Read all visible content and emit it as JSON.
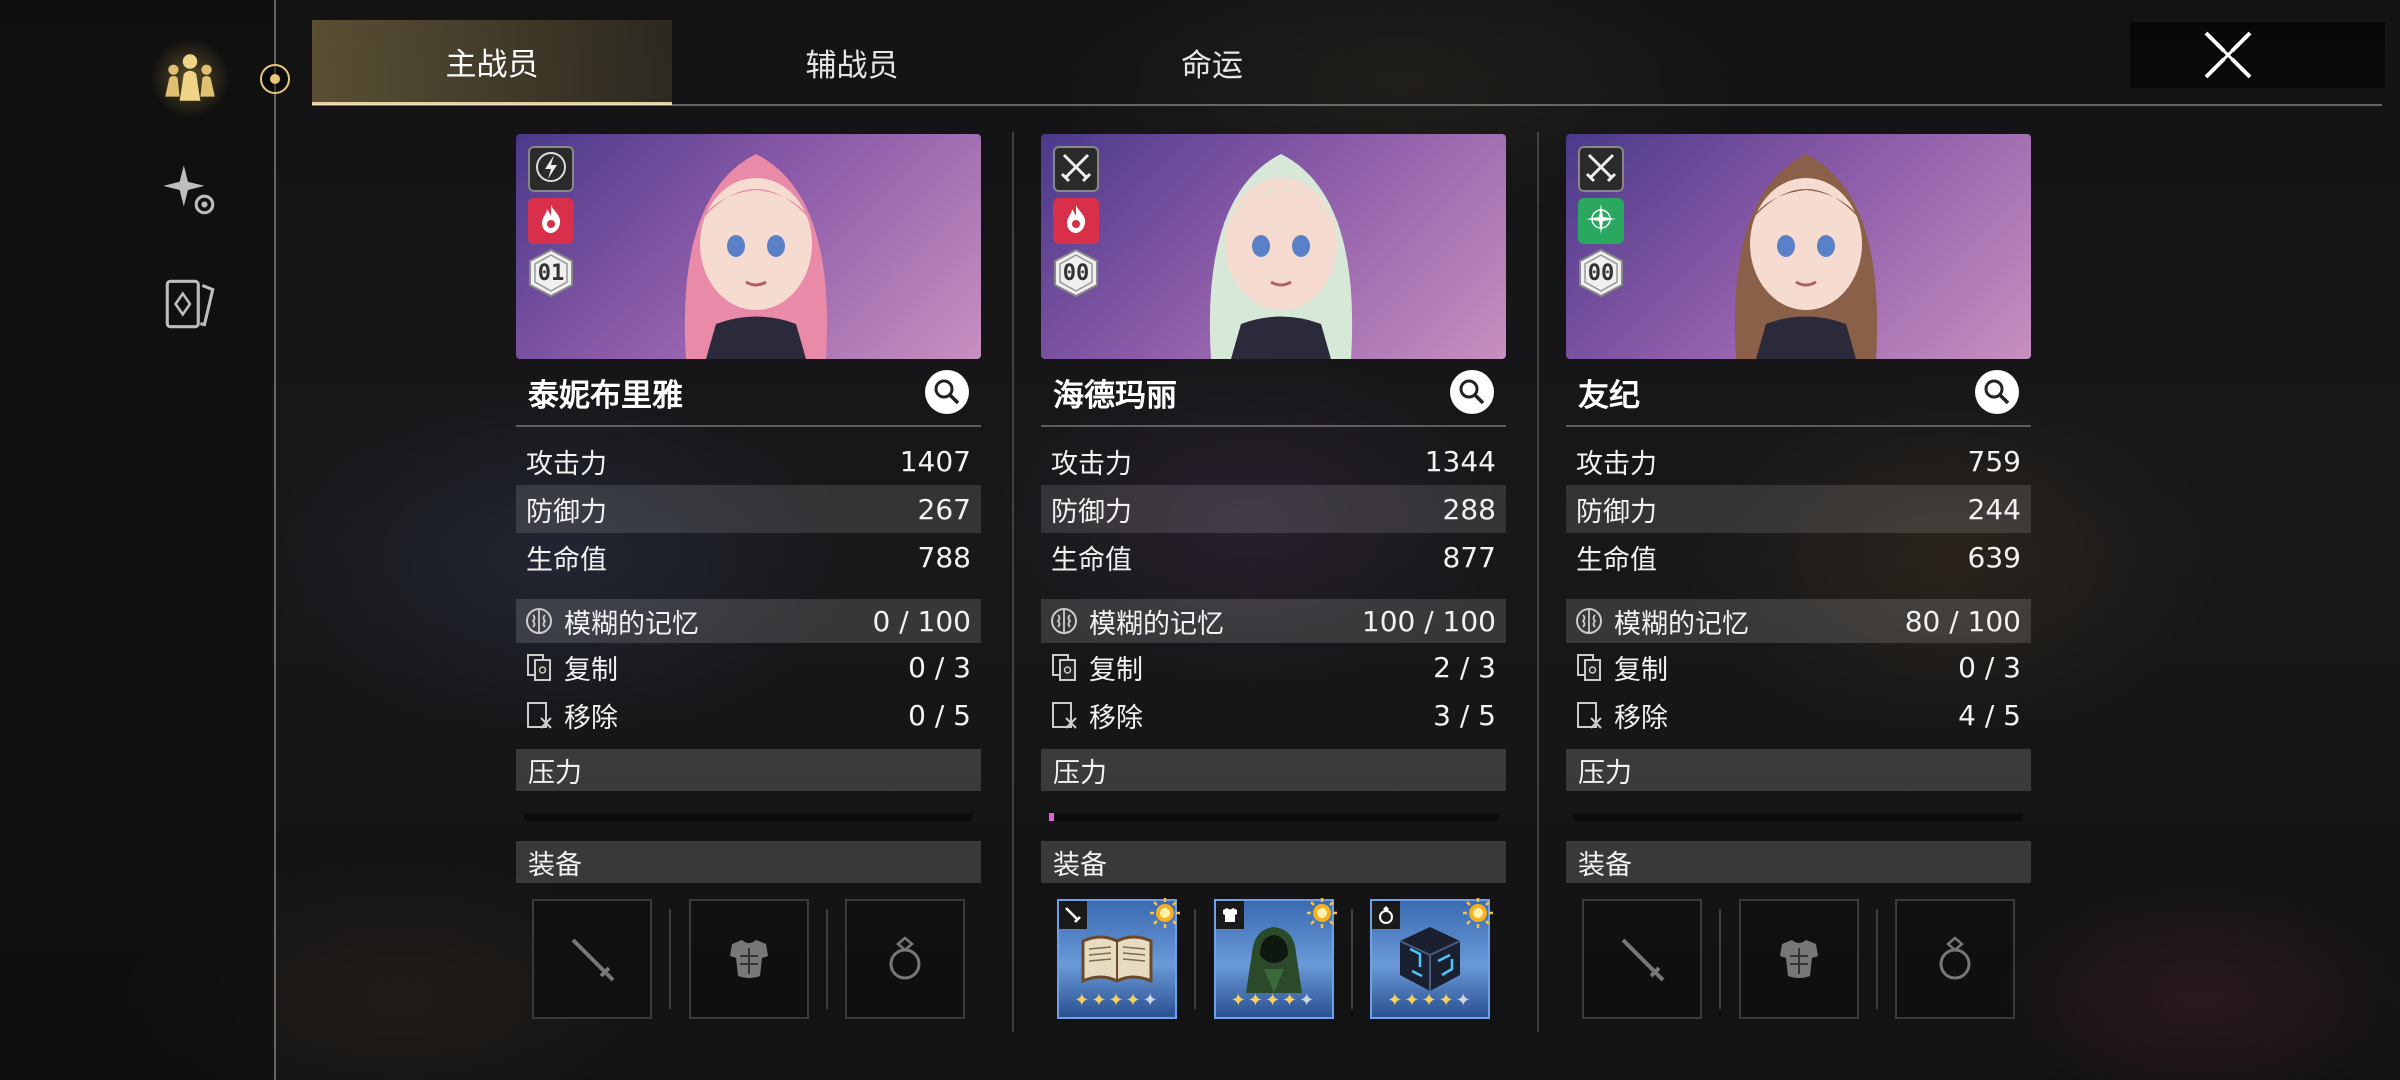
{
  "tabs": [
    {
      "label": "主战员",
      "active": true
    },
    {
      "label": "辅战员",
      "active": false
    },
    {
      "label": "命运",
      "active": false
    }
  ],
  "rail_icons": [
    "team-icon",
    "sparkle-icon",
    "card-icon"
  ],
  "labels": {
    "attack": "攻击力",
    "defense": "防御力",
    "hp": "生命值",
    "memory": "模糊的记忆",
    "copy": "复制",
    "remove": "移除",
    "pressure": "压力",
    "equipment": "装备"
  },
  "characters": [
    {
      "name": "泰妮布里雅",
      "role_icon": "lightning-icon",
      "element_icon": "fire-icon",
      "element_color": "#d8304a",
      "rank": "01",
      "hair": "#e88aa8",
      "attack": "1407",
      "defense": "267",
      "hp": "788",
      "memory": "0 / 100",
      "copy": "0 / 3",
      "remove": "0 / 5",
      "pressure": 0,
      "equipment_filled": false
    },
    {
      "name": "海德玛丽",
      "role_icon": "crossed-swords-icon",
      "element_icon": "fire-icon",
      "element_color": "#d8304a",
      "rank": "00",
      "hair": "#d8e8d8",
      "attack": "1344",
      "defense": "288",
      "hp": "877",
      "memory": "100 / 100",
      "copy": "2 / 3",
      "remove": "3 / 5",
      "pressure": 0.01,
      "equipment_filled": true
    },
    {
      "name": "友纪",
      "role_icon": "crossed-swords-icon",
      "element_icon": "star-icon",
      "element_color": "#2aa860",
      "rank": "00",
      "hair": "#8a6048",
      "attack": "759",
      "defense": "244",
      "hp": "639",
      "memory": "80 / 100",
      "copy": "0 / 3",
      "remove": "4 / 5",
      "pressure": 0,
      "equipment_filled": false
    }
  ],
  "equipment_items": [
    {
      "slot": "weapon",
      "icon": "book-icon",
      "stars": 4,
      "max_stars": 5
    },
    {
      "slot": "armor",
      "icon": "hooded-figure-icon",
      "stars": 4,
      "max_stars": 5
    },
    {
      "slot": "accessory",
      "icon": "cube-icon",
      "stars": 4,
      "max_stars": 5
    }
  ]
}
